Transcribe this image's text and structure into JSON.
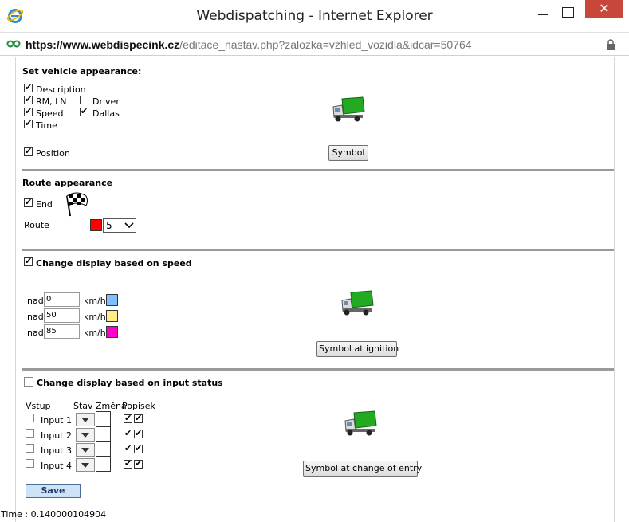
{
  "window": {
    "title": "Webdispatching - Internet Explorer",
    "close_glyph": "✕",
    "url_prefix": "https://www.",
    "url_host": "webdispecink.cz",
    "url_path": "/editace_nastav.php?zalozka=vzhled_vozidla&idcar=50764"
  },
  "appearance": {
    "heading": "Set vehicle appearance:",
    "options": {
      "description": "Description",
      "rm_ln": "RM, LN",
      "driver": "Driver",
      "speed": "Speed",
      "dallas": "Dallas",
      "time": "Time",
      "position": "Position"
    },
    "checked": {
      "description": true,
      "rm_ln": true,
      "driver": false,
      "speed": true,
      "dallas": true,
      "time": true,
      "position": true
    },
    "symbol_button": "Symbol"
  },
  "route": {
    "heading": "Route appearance",
    "end_label": "End",
    "end_checked": true,
    "route_label": "Route",
    "route_color": "#ff0000",
    "route_width": "5"
  },
  "speed": {
    "heading": "Change display based on speed",
    "checked": true,
    "rows": [
      {
        "prefix": "nad",
        "value": "0",
        "unit": "km/h",
        "color": "#7fbfff"
      },
      {
        "prefix": "nad",
        "value": "50",
        "unit": "km/h",
        "color": "#ffee88"
      },
      {
        "prefix": "nad",
        "value": "85",
        "unit": "km/h",
        "color": "#ff00cc"
      }
    ],
    "ignition_button": "Symbol at ignition"
  },
  "input_status": {
    "heading": "Change display based on input status",
    "checked": false,
    "columns": {
      "vstup": "Vstup",
      "stav": "Stav",
      "zmena": "Změna",
      "popisek": "Popisek"
    },
    "rows": [
      {
        "label": "Input 1"
      },
      {
        "label": "Input 2"
      },
      {
        "label": "Input 3"
      },
      {
        "label": "Input 4"
      }
    ],
    "entry_button": "Symbol at change of entry"
  },
  "save_button": "Save",
  "footer": {
    "time_text": "Time : 0.140000104904"
  }
}
